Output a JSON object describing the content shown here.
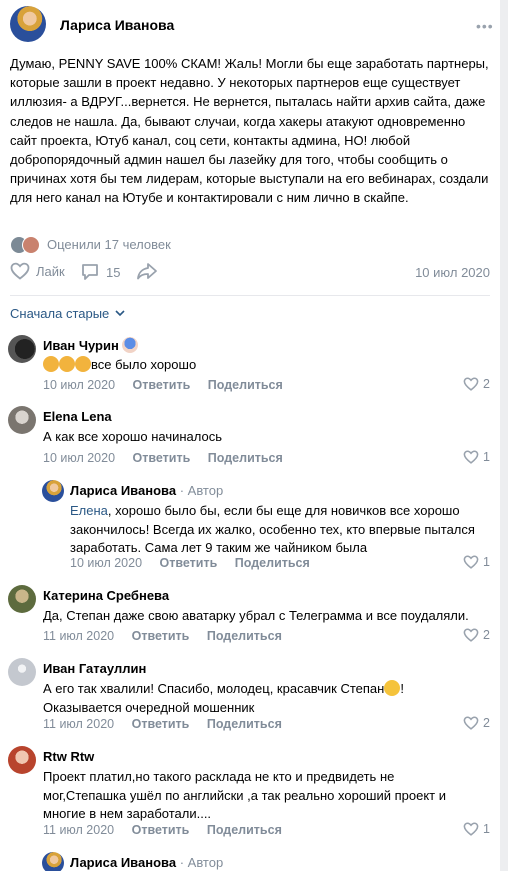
{
  "post": {
    "author": "Лариса Иванова",
    "text": "Думаю, PENNY SAVE 100% СКАМ! Жаль! Могли бы еще заработать партнеры, которые зашли в проект недавно. У некоторых партнеров еще существует иллюзия- а ВДРУГ...вернется. Не вернется, пыталась найти архив сайта, даже следов не нашла. Да, бывают случаи, когда хакеры атакуют одновременно сайт проекта, Ютуб канал, соц сети, контакты админа, НО! любой добропорядочный админ нашел бы лазейку для того, чтобы сообщить о причинах хотя бы тем лидерам, которые выступали на его вебинарах, создали для него канал на Ютубе и контактировали с ним лично в скайпе.",
    "rated": "Оценили 17 человек",
    "like_label": "Лайк",
    "comments_count": "15",
    "date": "10 июл 2020"
  },
  "sort_label": "Сначала старые",
  "reply_label": "Ответить",
  "share_label": "Поделиться",
  "comments": [
    {
      "name": "Иван Чурин",
      "text": "все было хорошо",
      "date": "10 июл 2020",
      "likes": "2"
    },
    {
      "name": "Elena Lena",
      "text": "А как все хорошо начиналось",
      "date": "10 июл 2020",
      "likes": "1"
    },
    {
      "name": "Лариса Иванова",
      "tag": "· Автор",
      "mention": "Елена",
      "text": ", хорошо было бы, если бы еще для новичков все хорошо закончилось! Всегда их жалко, особенно тех, кто впервые пытался заработать. Сама лет 9 таким же чайником была",
      "date": "10 июл 2020",
      "likes": "1"
    },
    {
      "name": "Катерина Сребнева",
      "text": "Да, Степан даже свою аватарку убрал с Телеграмма и все поудаляли.",
      "date": "11 июл 2020",
      "likes": "2"
    },
    {
      "name": "Иван Гатауллин",
      "text": "А его так хвалили! Спасибо, молодец, красавчик Степан",
      "text2": "! Оказывается очередной мошенник",
      "date": "11 июл 2020",
      "likes": "2"
    },
    {
      "name": "Rtw Rtw",
      "text": "Проект платил,но такого расклада не кто и предвидеть не мог,Степашка ушёл по английски ,а так реально хороший проект и многие в нем заработали....",
      "date": "11 июл 2020",
      "likes": "1"
    },
    {
      "name": "Лариса Иванова",
      "tag": "· Автор"
    }
  ],
  "colors": {
    "accent": "#2a5885",
    "muted": "#818c99",
    "icon": "#99a2ad"
  }
}
